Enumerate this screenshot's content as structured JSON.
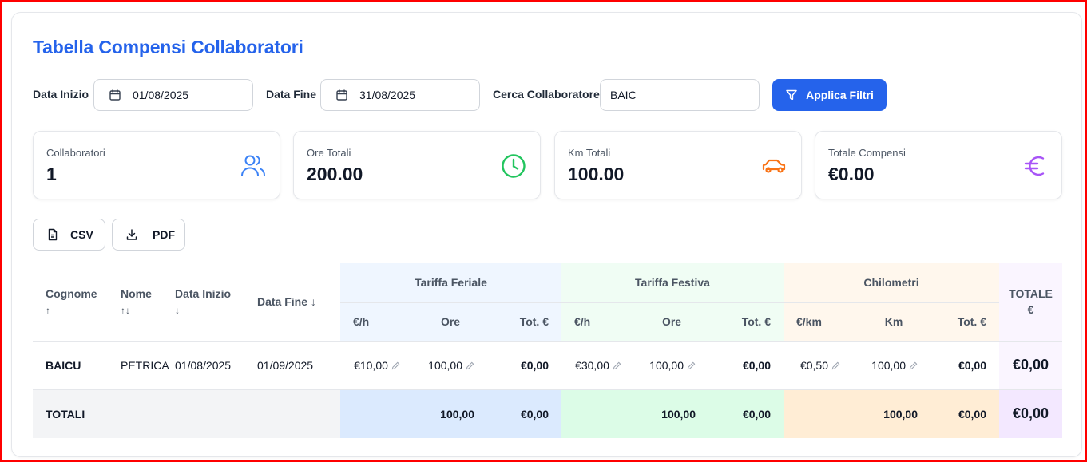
{
  "title": "Tabella Compensi Collaboratori",
  "filters": {
    "start_label": "Data Inizio",
    "start_value": "01/08/2025",
    "end_label": "Data Fine",
    "end_value": "31/08/2025",
    "search_label": "Cerca Collaboratore",
    "search_value": "BAIC",
    "apply_label": "Applica Filtri"
  },
  "stats": [
    {
      "label": "Collaboratori",
      "value": "1",
      "icon": "users-icon",
      "color": "#3b82f6"
    },
    {
      "label": "Ore Totali",
      "value": "200.00",
      "icon": "clock-icon",
      "color": "#22c55e"
    },
    {
      "label": "Km Totali",
      "value": "100.00",
      "icon": "car-icon",
      "color": "#f97316"
    },
    {
      "label": "Totale Compensi",
      "value": "€0.00",
      "icon": "euro-icon",
      "color": "#a855f7"
    }
  ],
  "export": {
    "csv_label": "CSV",
    "pdf_label": "PDF"
  },
  "table": {
    "headers": {
      "cognome": "Cognome",
      "cognome_sort": "↑",
      "nome": "Nome",
      "nome_sort": "↑↓",
      "data_inizio": "Data Inizio",
      "data_inizio_sort": "↓",
      "data_fine": "Data Fine ↓",
      "feriale": "Tariffa Feriale",
      "festiva": "Tariffa Festiva",
      "chilometri": "Chilometri",
      "totale": "TOTALE",
      "totale_unit": "€",
      "rate_h": "€/h",
      "ore": "Ore",
      "tot_eur": "Tot. €",
      "rate_km": "€/km",
      "km": "Km"
    },
    "rows": [
      {
        "cognome": "BAICU",
        "nome": "PETRICA",
        "data_inizio": "01/08/2025",
        "data_fine": "01/09/2025",
        "feriale_rate": "€10,00",
        "feriale_ore": "100,00",
        "feriale_tot": "€0,00",
        "festiva_rate": "€30,00",
        "festiva_ore": "100,00",
        "festiva_tot": "€0,00",
        "km_rate": "€0,50",
        "km": "100,00",
        "km_tot": "€0,00",
        "totale": "€0,00"
      }
    ],
    "totals": {
      "label": "TOTALI",
      "feriale_ore": "100,00",
      "feriale_tot": "€0,00",
      "festiva_ore": "100,00",
      "festiva_tot": "€0,00",
      "km": "100,00",
      "km_tot": "€0,00",
      "totale": "€0,00"
    }
  },
  "colors": {
    "accent": "#2563eb"
  }
}
